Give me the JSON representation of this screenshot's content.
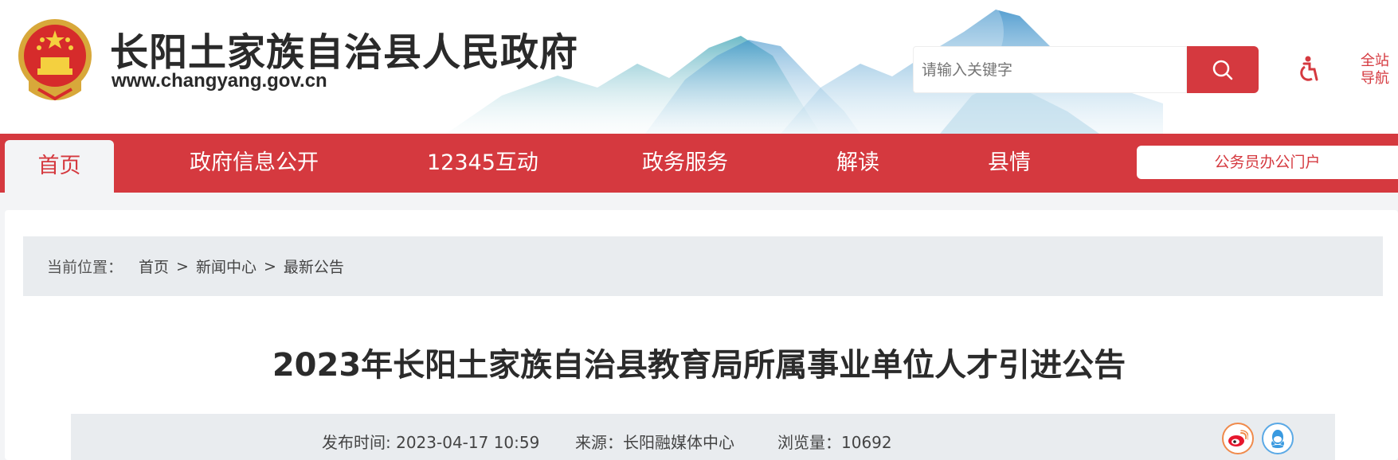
{
  "header": {
    "site_title": "长阳土家族自治县人民政府",
    "site_url": "www.changyang.gov.cn",
    "search_placeholder": "请输入关键字",
    "sitemap_line1": "全站",
    "sitemap_line2": "导航",
    "brand_color": "#d5393f"
  },
  "nav": {
    "items": [
      {
        "label": "首页",
        "active": true
      },
      {
        "label": "政府信息公开"
      },
      {
        "label": "12345互动"
      },
      {
        "label": "政务服务"
      },
      {
        "label": "解读"
      },
      {
        "label": "县情"
      }
    ],
    "portal_label": "公务员办公门户"
  },
  "breadcrumb": {
    "prefix": "当前位置：",
    "items": [
      "首页",
      "新闻中心",
      "最新公告"
    ],
    "separator": ">"
  },
  "article": {
    "title": "2023年长阳土家族自治县教育局所属事业单位人才引进公告",
    "publish_label": "发布时间:",
    "publish_time": "2023-04-17 10:59",
    "source_label": "来源：",
    "source": "长阳融媒体中心",
    "views_label": "浏览量：",
    "views": "10692"
  },
  "share": {
    "icons": [
      "weibo-icon",
      "qq-icon"
    ]
  }
}
